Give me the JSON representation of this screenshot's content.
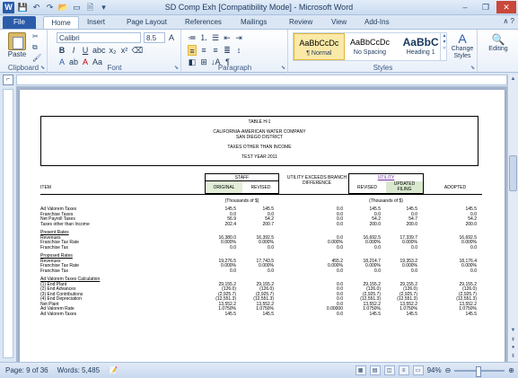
{
  "window": {
    "title": "SD Comp Exh [Compatibility Mode] - Microsoft Word",
    "app_icon": "W"
  },
  "ribbon_tabs": [
    "File",
    "Home",
    "Insert",
    "Page Layout",
    "References",
    "Mailings",
    "Review",
    "View",
    "Add-Ins"
  ],
  "ribbon": {
    "font_name": "Calibri",
    "font_size": "8.5",
    "paste_label": "Paste",
    "groups": {
      "clipboard": "Clipboard",
      "font": "Font",
      "paragraph": "Paragraph",
      "styles": "Styles",
      "editing": "Editing"
    },
    "styles": [
      {
        "sample": "AaBbCcDc",
        "name": "¶ Normal"
      },
      {
        "sample": "AaBbCcDc",
        "name": "No Spacing"
      },
      {
        "sample": "AaBbC",
        "name": "Heading 1"
      }
    ],
    "change_styles": "Change Styles",
    "editing_label": "Editing"
  },
  "document": {
    "header": {
      "table_no": "TABLE H-1",
      "company": "CALIFORNIA-AMERICAN WATER COMPANY",
      "district": "SAN DIEGO DISTRICT",
      "subject": "TAXES OTHER THAN INCOME",
      "test_year": "TEST YEAR 2011"
    },
    "columns": {
      "staff": "STAFF",
      "original": "ORIGINAL",
      "revised": "REVISED",
      "utility_exceeds": "UTILITY EXCEEDS BRANCH DIFFERENCE",
      "utility": "UTILITY",
      "revised_u": "REVISED",
      "updated_filing": "UPDATED FILING",
      "adopted": "ADOPTED",
      "item": "ITEM",
      "thousands_left": "(Thousands of $)",
      "thousands_right": "(Thousands of $)"
    },
    "rows": [
      {
        "label": "Ad Valorem Taxes",
        "v": [
          "145.5",
          "145.5",
          "0.0",
          "145.5",
          "145.5",
          "145.5"
        ]
      },
      {
        "label": "Franchise Taxes",
        "v": [
          "0.0",
          "0.0",
          "0.0",
          "0.0",
          "0.0",
          "0.0"
        ]
      },
      {
        "label": "Net Payroll Taxes",
        "v": [
          "56.9",
          "54.2",
          "0.0",
          "54.2",
          "54.7",
          "54.2"
        ]
      },
      {
        "label": "Taxes other than Income",
        "v": [
          "202.4",
          "200.7",
          "0.0",
          "200.0",
          "200.0",
          "200.0"
        ]
      },
      {
        "label": "Present Rates",
        "v": [
          "",
          "",
          "",
          "",
          "",
          ""
        ],
        "section": true
      },
      {
        "label": "Revenues",
        "v": [
          "16,380.0",
          "16,392.5",
          "0.0",
          "16,692.5",
          "17,339.7",
          "16,692.5"
        ]
      },
      {
        "label": "Franchise Tax Rate",
        "v": [
          "0.000%",
          "0.000%",
          "0.000%",
          "0.000%",
          "0.000%",
          "0.000%"
        ]
      },
      {
        "label": "Franchise Tax",
        "v": [
          "0.0",
          "0.0",
          "0.0",
          "0.0",
          "0.0",
          "0.0"
        ]
      },
      {
        "label": "Proposed Rates",
        "v": [
          "",
          "",
          "",
          "",
          "",
          ""
        ],
        "section": true
      },
      {
        "label": "Revenues",
        "v": [
          "19,276.5",
          "17,743.5",
          "455.2",
          "18,214.7",
          "19,353.2",
          "18,176.4"
        ]
      },
      {
        "label": "Franchise Tax Rate",
        "v": [
          "0.000%",
          "0.000%",
          "0.000%",
          "0.000%",
          "0.000%",
          "0.000%"
        ]
      },
      {
        "label": "Franchise Tax",
        "v": [
          "0.0",
          "0.0",
          "0.0",
          "0.0",
          "0.0",
          "0.0"
        ]
      },
      {
        "label": "Ad Valorem Taxes Calculation",
        "v": [
          "",
          "",
          "",
          "",
          "",
          ""
        ],
        "section": true
      },
      {
        "label": "(1) End Plant",
        "v": [
          "29,155.2",
          "29,155.2",
          "0.0",
          "29,155.2",
          "29,155.2",
          "29,155.2"
        ]
      },
      {
        "label": "(2) End Advances",
        "v": [
          "(126.0)",
          "(126.0)",
          "0.0",
          "(126.0)",
          "(126.0)",
          "(126.0)"
        ]
      },
      {
        "label": "(3) End Contributions",
        "v": [
          "(2,925.7)",
          "(2,925.7)",
          "0.0",
          "(2,925.7)",
          "(2,925.7)",
          "(2,925.7)"
        ]
      },
      {
        "label": "(4) End Depreciation",
        "v": [
          "(12,551.3)",
          "(12,551.3)",
          "0.0",
          "(12,551.3)",
          "(12,551.3)",
          "(12,551.3)"
        ]
      },
      {
        "label": "Net Plant",
        "v": [
          "13,552.2",
          "13,552.2",
          "0.0",
          "13,552.2",
          "13,552.2",
          "13,552.2"
        ]
      },
      {
        "label": "Ad Valorem Rate",
        "v": [
          "1.0750%",
          "1.0750%",
          "0.00000",
          "1.0750%",
          "1.0750%",
          "1.0750%"
        ]
      },
      {
        "label": "Ad Valorem Taxes",
        "v": [
          "145.5",
          "145.5",
          "0.0",
          "145.5",
          "145.5",
          "145.5"
        ]
      }
    ]
  },
  "status": {
    "page": "Page: 9 of 36",
    "words": "Words: 5,485",
    "zoom": "94%"
  }
}
